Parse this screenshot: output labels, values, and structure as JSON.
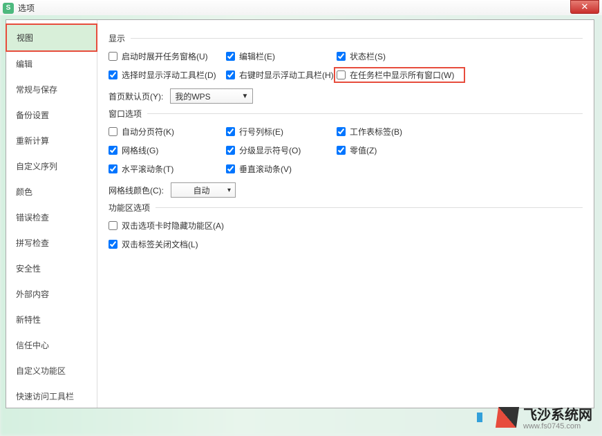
{
  "title": "选项",
  "app_icon_letter": "S",
  "close_label": "✕",
  "sidebar": {
    "items": [
      {
        "label": "视图"
      },
      {
        "label": "编辑"
      },
      {
        "label": "常规与保存"
      },
      {
        "label": "备份设置"
      },
      {
        "label": "重新计算"
      },
      {
        "label": "自定义序列"
      },
      {
        "label": "颜色"
      },
      {
        "label": "错误检查"
      },
      {
        "label": "拼写检查"
      },
      {
        "label": "安全性"
      },
      {
        "label": "外部内容"
      },
      {
        "label": "新特性"
      },
      {
        "label": "信任中心"
      },
      {
        "label": "自定义功能区"
      },
      {
        "label": "快速访问工具栏"
      }
    ]
  },
  "sections": {
    "display": {
      "header": "显示",
      "items": {
        "startup_pane": {
          "label": "启动时展开任务窗格(U)",
          "checked": false
        },
        "edit_bar": {
          "label": "编辑栏(E)",
          "checked": true
        },
        "status_bar": {
          "label": "状态栏(S)",
          "checked": true
        },
        "float_select": {
          "label": "选择时显示浮动工具栏(D)",
          "checked": true
        },
        "float_right": {
          "label": "右键时显示浮动工具栏(H)",
          "checked": true
        },
        "taskbar_all": {
          "label": "在任务栏中显示所有窗口(W)",
          "checked": false
        }
      },
      "homepage": {
        "label": "首页默认页(Y):",
        "value": "我的WPS"
      }
    },
    "window": {
      "header": "窗口选项",
      "items": {
        "auto_pagebreak": {
          "label": "自动分页符(K)",
          "checked": false
        },
        "row_col_hdr": {
          "label": "行号列标(E)",
          "checked": true
        },
        "sheet_tabs": {
          "label": "工作表标签(B)",
          "checked": true
        },
        "gridlines": {
          "label": "网格线(G)",
          "checked": true
        },
        "outline_sym": {
          "label": "分级显示符号(O)",
          "checked": true
        },
        "zero_val": {
          "label": "零值(Z)",
          "checked": true
        },
        "hscroll": {
          "label": "水平滚动条(T)",
          "checked": true
        },
        "vscroll": {
          "label": "垂直滚动条(V)",
          "checked": true
        }
      },
      "gridcolor": {
        "label": "网格线颜色(C):",
        "value": "自动"
      }
    },
    "ribbon": {
      "header": "功能区选项",
      "items": {
        "dbl_hide": {
          "label": "双击选项卡时隐藏功能区(A)",
          "checked": false
        },
        "dbl_close": {
          "label": "双击标签关闭文档(L)",
          "checked": true
        }
      }
    }
  },
  "watermark": {
    "title": "飞沙系统网",
    "sub": "www.fs0745.com"
  }
}
